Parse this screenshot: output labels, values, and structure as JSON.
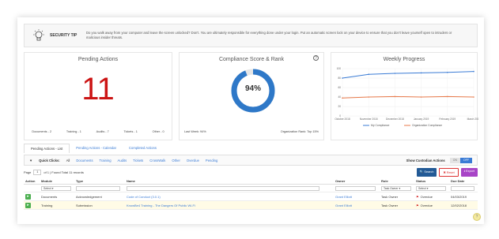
{
  "security_tip": {
    "title": "SECURITY TIP",
    "text": "Do you walk away from your computer and leave the screen unlocked? Don't. You are ultimately responsible for everything done under your login. Put an automatic screen lock on your device to ensure that you don't leave yourself open to intruders or malicious insider threats."
  },
  "pending_actions": {
    "title": "Pending Actions",
    "count": "11",
    "stats": [
      "Documents - 2",
      "Training - 1",
      "Audits - 7",
      "Tickets - 1",
      "Other - 0"
    ]
  },
  "compliance": {
    "title": "Compliance Score & Rank",
    "help": "?",
    "score_text": "94%",
    "score_fraction": 0.94,
    "last_week": "Last Week: 94%",
    "org_rank": "Organization Rank: Top 15%"
  },
  "chart_data": {
    "type": "line",
    "title": "Weekly Progress",
    "x": [
      "October 2018",
      "November 2018",
      "December 2018",
      "January 2019",
      "February 2019",
      "March 2019"
    ],
    "ylim": [
      0,
      100
    ],
    "yticks": [
      "100",
      "80",
      "60",
      "40",
      "20",
      "0"
    ],
    "series": [
      {
        "name": "My Compliance",
        "color": "#3a7bd5",
        "values": [
          80,
          88,
          90,
          91,
          92,
          94
        ]
      },
      {
        "name": "Organization Compliance",
        "color": "#e87a4b",
        "values": [
          38,
          40,
          41,
          40,
          41,
          40
        ]
      }
    ],
    "legend": "bottom"
  },
  "tabs": [
    "Pending Actions - List",
    "Pending Actions - Calendar",
    "Completed Actions"
  ],
  "quick_clicks": {
    "label": "Quick Clicks:",
    "items": [
      "All",
      "Documents",
      "Training",
      "Audits",
      "Tickets",
      "CrossWalk",
      "Other",
      "Overdue",
      "Pending"
    ],
    "custodian_label": "Show Custodian Actions",
    "toggle_on": "ON",
    "toggle_off": "OFF"
  },
  "pager": {
    "page_label": "Page",
    "page": "1",
    "summary": "of 1 | Found Total 11 records"
  },
  "buttons": {
    "search": "Search",
    "reset": "Reset",
    "export": "Export"
  },
  "table": {
    "headers": [
      "Action",
      "Module",
      "Type",
      "Name",
      "Owner",
      "Role",
      "Status",
      "Due Date"
    ],
    "filters": {
      "module": "Select",
      "role": "Task Owner",
      "status": "Select"
    },
    "rows": [
      {
        "module": "Documents",
        "type": "Acknowledgement",
        "name": "Code of Conduct (3.0.1)",
        "owner": "Grant Elliott",
        "role": "Task Owner",
        "status": "Overdue",
        "due": "04/03/2019"
      },
      {
        "module": "Training",
        "type": "Submission",
        "name": "KnowBe4 Training - The Dangers Of Public Wi-Fi",
        "owner": "Grant Elliott",
        "role": "Task Owner",
        "status": "Overdue",
        "due": "12/02/2018"
      }
    ]
  },
  "colors": {
    "accent": "#3a7bd5",
    "danger": "#cc1414",
    "success": "#4caf50",
    "export": "#a845c7"
  }
}
